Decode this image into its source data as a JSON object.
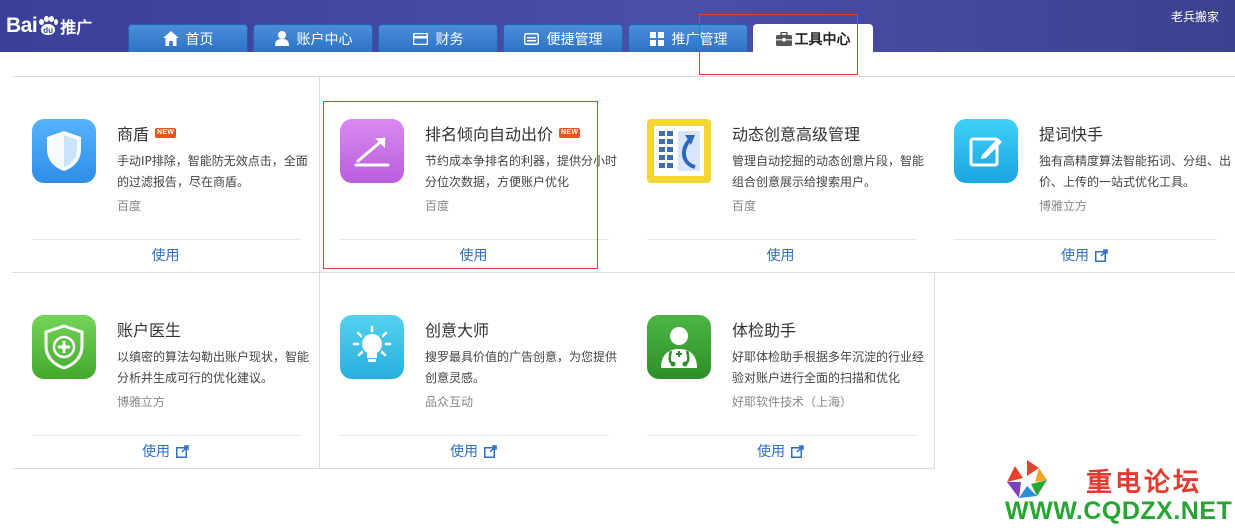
{
  "brand": {
    "logo_text": "Bai",
    "logo_paw_text": "du",
    "logo_suffix": "推广"
  },
  "user": {
    "name": "老兵搬家"
  },
  "tabs": [
    {
      "label": "首页",
      "icon": "home-icon"
    },
    {
      "label": "账户中心",
      "icon": "user-icon"
    },
    {
      "label": "财务",
      "icon": "card-icon"
    },
    {
      "label": "便捷管理",
      "icon": "window-icon"
    },
    {
      "label": "推广管理",
      "icon": "grid-icon"
    },
    {
      "label": "工具中心",
      "icon": "toolbox-icon",
      "active": true
    }
  ],
  "tools": [
    {
      "name": "商盾",
      "badge": "NEW",
      "desc": "手动IP排除，智能防无效点击，全面的过滤报告，尽在商盾。",
      "vendor": "百度",
      "action": "使用",
      "icon": "shield-icon",
      "color": "#3a9bef"
    },
    {
      "name": "排名倾向自动出价",
      "badge": "NEW",
      "desc": "节约成本争排名的利器，提供分小时分位次数据，方便账户优化",
      "vendor": "百度",
      "action": "使用",
      "icon": "trend-arrow-icon",
      "color": "#c96ee6"
    },
    {
      "name": "动态创意高级管理",
      "badge": "",
      "desc": "管理自动挖掘的动态创意片段，智能组合创意展示给搜索用户。",
      "vendor": "百度",
      "action": "使用",
      "icon": "dynamic-creative-icon",
      "color": "#f3d437"
    },
    {
      "name": "提词快手",
      "badge": "",
      "desc": "独有高精度算法智能拓词、分组、出价、上传的一站式优化工具。",
      "vendor": "博雅立方",
      "action": "使用",
      "icon": "edit-icon",
      "color": "#2bb6ea"
    },
    {
      "name": "账户医生",
      "badge": "",
      "desc": "以缜密的算法勾勒出账户现状，智能分析并生成可行的优化建议。",
      "vendor": "博雅立方",
      "action": "使用",
      "icon": "medical-shield-icon",
      "color": "#59c43f"
    },
    {
      "name": "创意大师",
      "badge": "",
      "desc": "搜罗最具价值的广告创意，为您提供创意灵感。",
      "vendor": "品众互动",
      "action": "使用",
      "icon": "lightbulb-icon",
      "color": "#3fc3e6"
    },
    {
      "name": "体检助手",
      "badge": "",
      "desc": "好耶体检助手根据多年沉淀的行业经验对账户进行全面的扫描和优化",
      "vendor": "好耶软件技术（上海）",
      "action": "使用",
      "icon": "doctor-icon",
      "color": "#3fa83a"
    }
  ],
  "watermark": {
    "title": "重电论坛",
    "url": "WWW.CQDZX.NET"
  }
}
